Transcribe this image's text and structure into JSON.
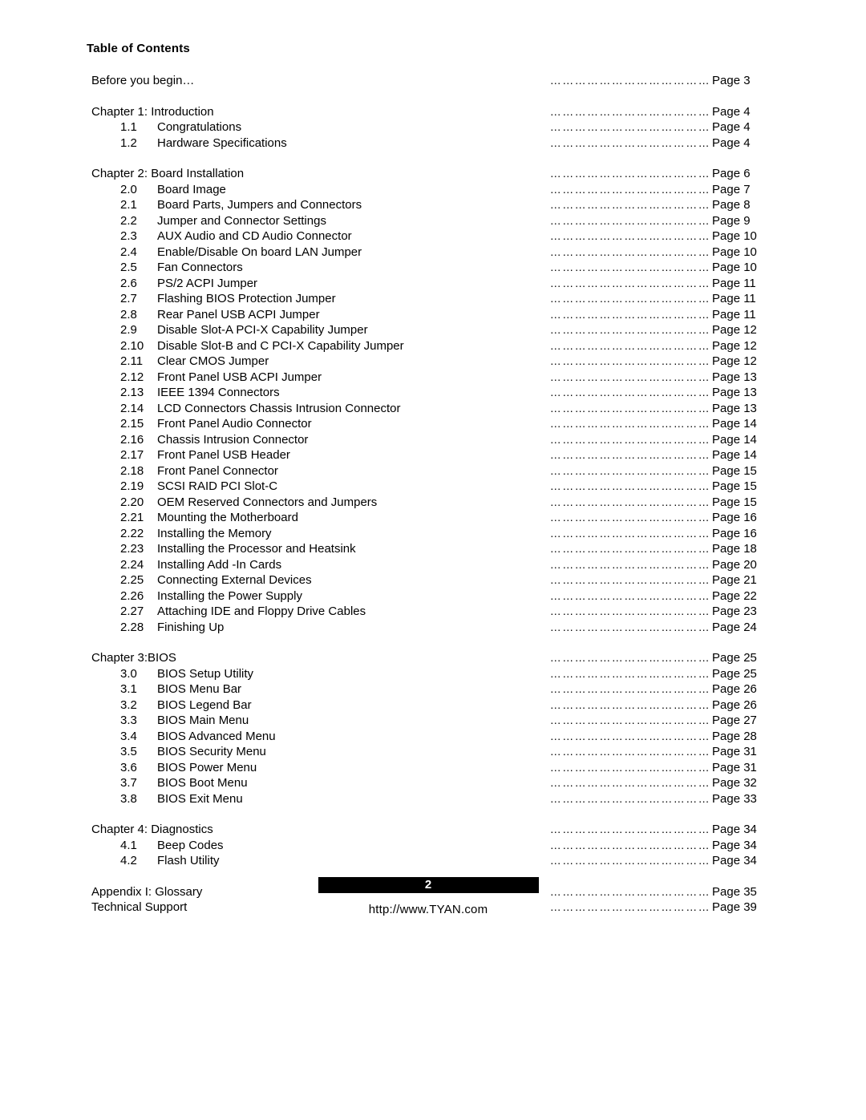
{
  "document": {
    "title": "Table of Contents",
    "footer": {
      "page_number": "2",
      "website": "http://www.TYAN.com"
    },
    "dots": "…………………………………",
    "entries": [
      {
        "level": 0,
        "num": "",
        "label": "Before you begin…",
        "page": "Page 3",
        "space_before": "none"
      },
      {
        "level": 0,
        "num": "",
        "label": "Chapter 1: Introduction",
        "page": "Page 4",
        "space_before": "large"
      },
      {
        "level": 1,
        "num": "1.1",
        "label": "Congratulations",
        "page": "Page 4",
        "space_before": "none"
      },
      {
        "level": 1,
        "num": "1.2",
        "label": "Hardware Specifications",
        "page": "Page  4",
        "space_before": "none"
      },
      {
        "level": 0,
        "num": "",
        "label": "Chapter 2: Board Installation",
        "page": "Page 6",
        "space_before": "large"
      },
      {
        "level": 1,
        "num": "2.0",
        "label": "Board Image",
        "page": "Page 7",
        "space_before": "none"
      },
      {
        "level": 1,
        "num": "2.1",
        "label": "Board Parts, Jumpers and Connectors",
        "page": "Page 8",
        "space_before": "none"
      },
      {
        "level": 1,
        "num": "2.2",
        "label": "Jumper and Connector Settings",
        "page": "Page 9",
        "space_before": "none"
      },
      {
        "level": 1,
        "num": "2.3",
        "label": "AUX Audio and CD Audio Connector",
        "page": "Page 10",
        "space_before": "none"
      },
      {
        "level": 1,
        "num": "2.4",
        "label": "Enable/Disable On board LAN Jumper",
        "page": "Page 10",
        "space_before": "none"
      },
      {
        "level": 1,
        "num": "2.5",
        "label": "Fan Connectors",
        "page": "Page 10",
        "space_before": "none"
      },
      {
        "level": 1,
        "num": "2.6",
        "label": "PS/2 ACPI Jumper",
        "page": "Page 11",
        "space_before": "none"
      },
      {
        "level": 1,
        "num": "2.7",
        "label": "Flashing BIOS Protection Jumper",
        "page": "Page 11",
        "space_before": "none"
      },
      {
        "level": 1,
        "num": "2.8",
        "label": "Rear Panel USB ACPI Jumper",
        "page": "Page 11",
        "space_before": "none"
      },
      {
        "level": 1,
        "num": "2.9",
        "label": "Disable Slot-A PCI-X Capability Jumper",
        "page": "Page 12",
        "space_before": "none"
      },
      {
        "level": 1,
        "num": "2.10",
        "label": "Disable Slot-B and C PCI-X Capability Jumper",
        "page": "Page 12",
        "space_before": "none"
      },
      {
        "level": 1,
        "num": "2.11",
        "label": "Clear CMOS Jumper",
        "page": "Page 12",
        "space_before": "none"
      },
      {
        "level": 1,
        "num": "2.12",
        "label": "Front Panel USB ACPI Jumper",
        "page": "Page 13",
        "space_before": "none"
      },
      {
        "level": 1,
        "num": "2.13",
        "label": "IEEE 1394 Connectors",
        "page": "Page 13",
        "space_before": "none"
      },
      {
        "level": 1,
        "num": "2.14",
        "label": "LCD Connectors Chassis Intrusion Connector",
        "page": "Page 13",
        "space_before": "none"
      },
      {
        "level": 1,
        "num": "2.15",
        "label": "Front Panel Audio Connector",
        "page": "Page 14",
        "space_before": "none"
      },
      {
        "level": 1,
        "num": "2.16",
        "label": "Chassis Intrusion Connector",
        "page": "Page 14",
        "space_before": "none"
      },
      {
        "level": 1,
        "num": "2.17",
        "label": "Front Panel USB Header",
        "page": "Page 14",
        "space_before": "none"
      },
      {
        "level": 1,
        "num": "2.18",
        "label": "Front Panel Connector",
        "page": "Page 15",
        "space_before": "none"
      },
      {
        "level": 1,
        "num": "2.19",
        "label": "SCSI RAID PCI Slot-C",
        "page": "Page 15",
        "space_before": "none"
      },
      {
        "level": 1,
        "num": "2.20",
        "label": "OEM Reserved Connectors and Jumpers",
        "page": "Page 15",
        "space_before": "none"
      },
      {
        "level": 1,
        "num": "2.21",
        "label": "Mounting the Motherboard",
        "page": "Page 16",
        "space_before": "none"
      },
      {
        "level": 1,
        "num": "2.22",
        "label": "Installing the Memory",
        "page": "Page 16",
        "space_before": "none"
      },
      {
        "level": 1,
        "num": "2.23",
        "label": "Installing the Processor and Heatsink",
        "page": "Page 18",
        "space_before": "none"
      },
      {
        "level": 1,
        "num": "2.24",
        "label": "Installing Add -In Cards",
        "page": "Page 20",
        "space_before": "none"
      },
      {
        "level": 1,
        "num": "2.25",
        "label": "Connecting External Devices",
        "page": "Page 21",
        "space_before": "none"
      },
      {
        "level": 1,
        "num": "2.26",
        "label": "Installing the Power Supply",
        "page": "Page 22",
        "space_before": "none"
      },
      {
        "level": 1,
        "num": "2.27",
        "label": "Attaching IDE and Floppy Drive Cables",
        "page": "Page 23",
        "space_before": "none"
      },
      {
        "level": 1,
        "num": "2.28",
        "label": "Finishing Up",
        "page": "Page 24",
        "space_before": "none"
      },
      {
        "level": 0,
        "num": "",
        "label": "Chapter 3:BIOS",
        "page": "Page 25",
        "space_before": "large"
      },
      {
        "level": 1,
        "num": "3.0",
        "label": "BIOS Setup Utility",
        "page": "Page 25",
        "space_before": "none"
      },
      {
        "level": 1,
        "num": "3.1",
        "label": "BIOS Menu Bar",
        "page": "Page 26",
        "space_before": "none"
      },
      {
        "level": 1,
        "num": "3.2",
        "label": "BIOS Legend Bar",
        "page": "Page 26",
        "space_before": "none"
      },
      {
        "level": 1,
        "num": "3.3",
        "label": "BIOS Main Menu",
        "page": "Page 27",
        "space_before": "none"
      },
      {
        "level": 1,
        "num": "3.4",
        "label": "BIOS Advanced Menu",
        "page": "Page 28",
        "space_before": "none"
      },
      {
        "level": 1,
        "num": "3.5",
        "label": "BIOS Security Menu",
        "page": "Page 31",
        "space_before": "none"
      },
      {
        "level": 1,
        "num": "3.6",
        "label": "BIOS Power Menu",
        "page": "Page 31",
        "space_before": "none"
      },
      {
        "level": 1,
        "num": "3.7",
        "label": "BIOS Boot Menu",
        "page": "Page 32",
        "space_before": "none"
      },
      {
        "level": 1,
        "num": "3.8",
        "label": "BIOS Exit Menu",
        "page": "Page 33",
        "space_before": "none"
      },
      {
        "level": 0,
        "num": "",
        "label": "Chapter 4: Diagnostics",
        "page": "Page 34",
        "space_before": "large"
      },
      {
        "level": 1,
        "num": "4.1",
        "label": "Beep Codes",
        "page": "Page 34",
        "space_before": "none"
      },
      {
        "level": 1,
        "num": "4.2",
        "label": "Flash Utility",
        "page": "Page 34",
        "space_before": "none"
      },
      {
        "level": 0,
        "num": "",
        "label": "Appendix I: Glossary",
        "page": "Page 35",
        "space_before": "large"
      },
      {
        "level": 0,
        "num": "",
        "label": "Technical Support",
        "page": "Page 39",
        "space_before": "none"
      }
    ]
  }
}
